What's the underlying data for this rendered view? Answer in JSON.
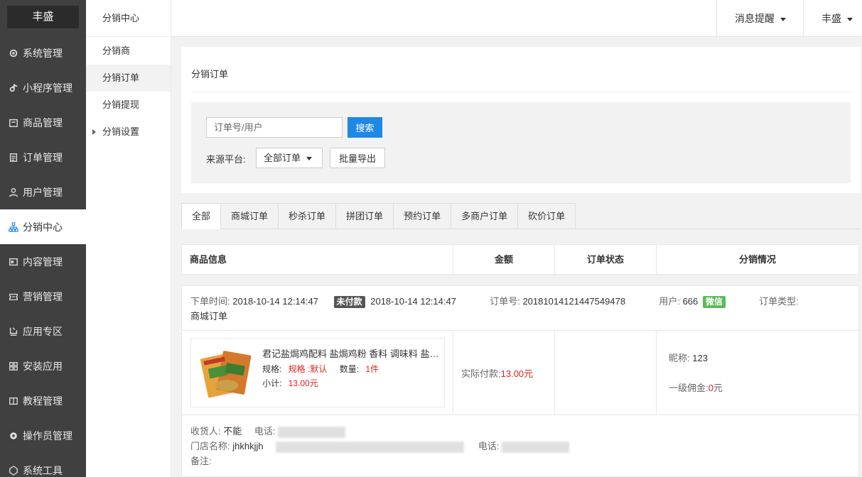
{
  "brand": "丰盛",
  "sidebar": {
    "items": [
      {
        "label": "系统管理",
        "icon": "gear-icon"
      },
      {
        "label": "小程序管理",
        "icon": "tiktok-note-icon"
      },
      {
        "label": "商品管理",
        "icon": "box-icon"
      },
      {
        "label": "订单管理",
        "icon": "clipboard-icon"
      },
      {
        "label": "用户管理",
        "icon": "user-icon"
      },
      {
        "label": "分销中心",
        "icon": "sitemap-icon"
      },
      {
        "label": "内容管理",
        "icon": "content-icon"
      },
      {
        "label": "营销管理",
        "icon": "ticket-icon"
      },
      {
        "label": "应用专区",
        "icon": "apps-icon"
      },
      {
        "label": "安装应用",
        "icon": "grid-icon"
      },
      {
        "label": "教程管理",
        "icon": "book-icon"
      },
      {
        "label": "操作员管理",
        "icon": "cog-user-icon"
      },
      {
        "label": "系统工具",
        "icon": "tools-icon"
      }
    ]
  },
  "subbar": {
    "title": "分销中心",
    "items": [
      {
        "label": "分销商"
      },
      {
        "label": "分销订单"
      },
      {
        "label": "分销提现"
      },
      {
        "label": "分销设置"
      }
    ]
  },
  "topbar": {
    "notifications": "消息提醒",
    "user": "丰盛"
  },
  "page": {
    "title": "分销订单",
    "search_placeholder": "订单号/用户",
    "search_btn": "搜索",
    "source_label": "来源平台:",
    "source_value": "全部订单",
    "export_btn": "批量导出"
  },
  "tabs": [
    "全部",
    "商城订单",
    "秒杀订单",
    "拼团订单",
    "预约订单",
    "多商户订单",
    "砍价订单"
  ],
  "table": {
    "headers": [
      "商品信息",
      "金额",
      "订单状态",
      "分销情况"
    ]
  },
  "order": {
    "time_label": "下单时间:",
    "time": "2018-10-14 12:14:47",
    "status_badge": "未付款",
    "time2": "2018-10-14 12:14:47",
    "order_no_label": "订单号:",
    "order_no": "20181014121447549478",
    "user_label": "用户:",
    "user": "666",
    "platform_badge": "微信",
    "type_label": "订单类型:",
    "type": "商城订单",
    "goods_name": "君记盐焗鸡配料 盐焗鸡粉 香料 调味料 盐焗鸡",
    "spec_label": "规格:",
    "spec_value": "规格 :默认",
    "qty_label": "数量:",
    "qty_value": "1件",
    "subtotal_label": "小计:",
    "subtotal_value": "13.00元",
    "paid_label": "实际付款:",
    "paid_value": "13.00元",
    "nickname_label": "昵称:",
    "nickname": "123",
    "commission_label": "一级佣金:",
    "commission_value": "0",
    "commission_unit": "元",
    "receiver_label": "收货人:",
    "receiver": "不能",
    "phone_label": "电话:",
    "store_label": "门店名称:",
    "store": "jhkhkjjh",
    "store_phone_label": "电话:",
    "remark_label": "备注:"
  }
}
